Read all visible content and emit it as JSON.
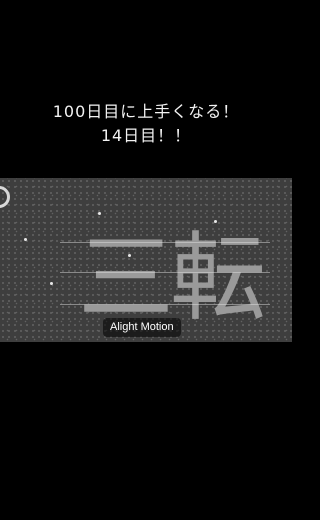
{
  "caption": {
    "line1": "100日目に上手くなる！",
    "line2": "14日目！！"
  },
  "video": {
    "big_text": "三転",
    "watermark": "Alight Motion"
  },
  "colors": {
    "background": "#000000",
    "video_bg": "#3e3e3e",
    "big_text": "#9a9a9a"
  }
}
